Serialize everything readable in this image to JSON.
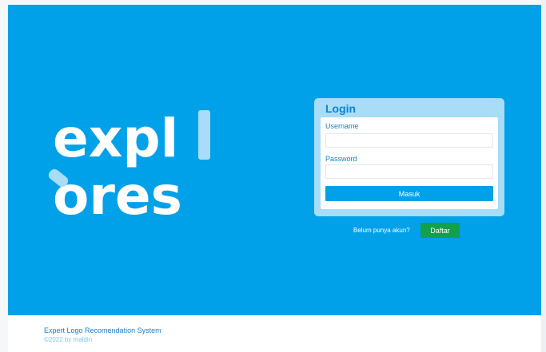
{
  "brand": {
    "logo_text_line1": "expl",
    "logo_text_line2": "ores",
    "colors": {
      "hero_background": "#00a1e9",
      "logo_white": "#ffffff",
      "logo_accent": "#a9dcf6",
      "primary_button": "#00a1e9",
      "signup_button": "#13a04a"
    }
  },
  "login": {
    "title": "Login",
    "username_label": "Username",
    "username_value": "",
    "password_label": "Password",
    "password_value": "",
    "submit_label": "Masuk"
  },
  "signup": {
    "prompt": "Belum punya akun?",
    "button_label": "Daftar"
  },
  "footer": {
    "title": "Expert Logo Recomendation System",
    "copyright": "©2022 by maldin"
  }
}
